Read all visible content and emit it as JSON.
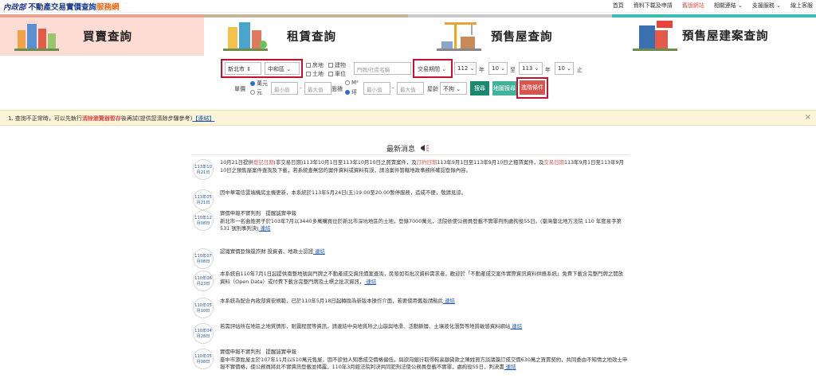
{
  "logo": {
    "mark": "內政部",
    "main": "不動產交易實價查詢",
    "accent": "服務網"
  },
  "topnav": [
    "首頁",
    "資料下載及申請",
    "舊版網站",
    "相關連結 ⌄",
    "支援服務 ⌄",
    "線上客服"
  ],
  "tabs": [
    "買賣查詢",
    "租賃查詢",
    "預售屋查詢",
    "預售屋建案查詢"
  ],
  "form": {
    "city": "新北市 ⇕",
    "district": "中和區 ⌄",
    "chk_house": "房地",
    "chk_build": "建物",
    "chk_land": "土地",
    "chk_car": "車位",
    "address_placeholder": "門牌/社區名稱",
    "period_label": "交易期間 ⌄",
    "y1": "112 ⌄",
    "m1": "10 ⌄",
    "y2": "113 ⌄",
    "m2": "10 ⌄",
    "nian": "年",
    "zhi": "至",
    "zhi2": "止",
    "price_label": "單價",
    "unit_wan": "萬元",
    "unit_yuan": "元",
    "min": "最小值",
    "max": "最大值",
    "dash": "-",
    "area_label": "面積",
    "unit_m2": "M²",
    "unit_ping": "坪",
    "age_label": "屋齡",
    "age_sel": "不拘 ⌄",
    "search_btn": "搜尋",
    "map_btn": "地圖搜尋",
    "adv_btn": "進階條件"
  },
  "notice": {
    "a": "1. 查詢不正常時，可以先執行",
    "b": "清除瀏覽器暫存",
    "c": "後再試(提供您清除步驟參考)",
    "d": "【連結】",
    "close": "×"
  },
  "news_title": "最新消息",
  "news": [
    {
      "d1": "113年10",
      "d2": "月21日",
      "parts": [
        [
          "10月21日提供",
          ""
        ],
        [
          "登記日期",
          "r"
        ],
        [
          "(非交易日期)113年10月1日至113年10月10日之買賣案件，及",
          ""
        ],
        [
          "訂約日期",
          "r"
        ],
        [
          "113年9月1日至113年9月10日之租賃案件，及",
          ""
        ],
        [
          "交易日期",
          "r"
        ],
        [
          "113年9月1日至113年9月10日之預售屋案件查詢及下載，若系統查無您的案件資料或資料有誤，請洽案件管轄地政事務所確認登錄內容。",
          ""
        ]
      ]
    },
    {
      "d1": "113年05",
      "d2": "月21日",
      "parts": [
        [
          "因中華電信雲端機房主機更新，本系統於113年5月24日(五)19:00至20:00暫停服務，造成不便，敬請見諒。",
          ""
        ]
      ]
    },
    {
      "d1": "110年12",
      "d2": "月08日",
      "parts": [
        [
          "實價申報不實判刑　提醒誠實申報",
          ""
        ],
        [
          "新北市一名曲姓男子於103年7月以3440多萬購買位於新北市深坑地區的土地，登錄7000萬元，法院依使公務員登載不實罪判刑處拘役55日。(臺灣臺北地方法院 110 年度易字第 531 號刑事判決)",
          ""
        ],
        [
          " 連結",
          "lk"
        ]
      ]
    },
    {
      "d1": "110年07",
      "d2": "月08日",
      "parts": [
        [
          "認識實價登錄還詐財 投資者、地政士認證",
          ""
        ],
        [
          " 連結",
          "lk"
        ]
      ]
    },
    {
      "d1": "110年06",
      "d2": "月23日",
      "parts": [
        [
          "本系統自110年7月1日起提供南整地號與門牌之不動產成交資訊價案查詢，民眾如有批次資料需求者，歡迎於「不動產成交案件實際資訊資料供應系統」免費下載含完整門牌之開放資料（Open Data）或付費下載含完整門牌及土標之批次資訊，",
          ""
        ],
        [
          " 連結",
          "lk"
        ]
      ]
    },
    {
      "d1": "110年05",
      "d2": "月10日",
      "parts": [
        [
          "本系統為配合內政部資安規範，已於110年5月18日起轉換為新版本操作介面，若要使用舊版請點此",
          ""
        ],
        [
          " 連結",
          "lk"
        ]
      ]
    },
    {
      "d1": "110年04",
      "d2": "月28日",
      "parts": [
        [
          "若需評估所在地區之地質情形，耐震程度等資訊，請連結中央地質所之山崩與地滑、活動斷層、土壤液化潛勢等地質敏感資料網站",
          ""
        ],
        [
          " 連結",
          "lk"
        ]
      ]
    },
    {
      "d1": "110年05",
      "d2": "月08日",
      "parts": [
        [
          "實價申報不實判刑　提醒誠實申報",
          ""
        ],
        [
          "臺中市游姓屋主於107年11月以510萬元售屋，因不欲他人知悉成交價格偏低，與欲向銀行取得較高額貸款之陳姓買方談議簽訂成交價630萬之買賣契約，共同委由不知情之地政士申報不實價格，使公務員將此不實資訊登載並揭露，110年3月經法院判決共同犯刑法使公務員登載不實罪，處拘役55日，判決書",
          ""
        ],
        [
          " 連結",
          "lk"
        ]
      ]
    }
  ],
  "colors": {
    "accent_red": "#c8102e",
    "tab1_bg": "#fcdcd3",
    "search_green": "#1a8a6f"
  }
}
